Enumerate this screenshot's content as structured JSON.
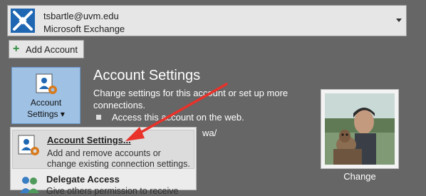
{
  "account": {
    "email": "tsbartle@uvm.edu",
    "type": "Microsoft Exchange"
  },
  "add_account": {
    "label": "Add Account"
  },
  "settings_button": {
    "line1": "Account",
    "line2": "Settings ▾"
  },
  "section": {
    "title": "Account Settings",
    "desc_line1": "Change settings for this account or set up more",
    "desc_line2": "connections.",
    "bullet": "Access this account on the web.",
    "url_fragment": "wa/"
  },
  "profile": {
    "change_label": "Change"
  },
  "dropdown": {
    "items": [
      {
        "title": "Account Settings...",
        "desc_line1": "Add and remove accounts or",
        "desc_line2": "change existing connection settings."
      },
      {
        "title": "Delegate Access",
        "desc": "Give others permission to receive"
      }
    ]
  },
  "colors": {
    "background": "#666666",
    "button_selected": "#9fc1e4",
    "arrow": "#e8322a"
  }
}
